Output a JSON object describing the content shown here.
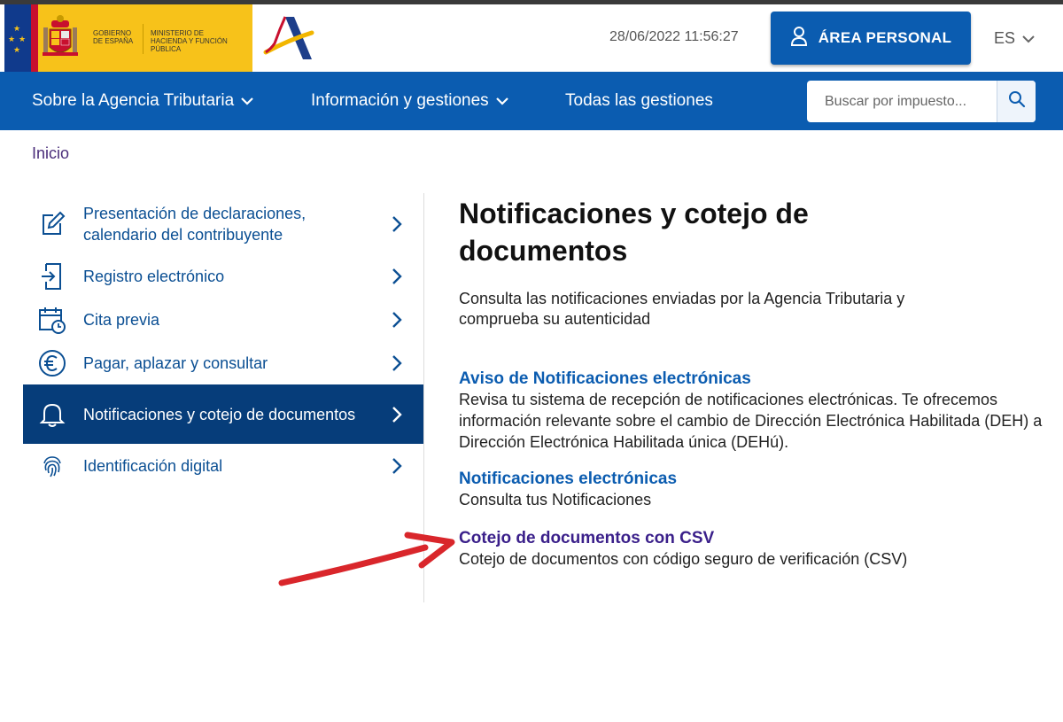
{
  "header": {
    "logo_gobierno": "GOBIERNO DE ESPAÑA",
    "logo_ministerio": "MINISTERIO DE HACIENDA Y FUNCIÓN PÚBLICA",
    "datetime": "28/06/2022 11:56:27",
    "area_personal_label": "ÁREA PERSONAL",
    "lang": "ES"
  },
  "nav": {
    "items": [
      {
        "label": "Sobre la Agencia Tributaria"
      },
      {
        "label": "Información y gestiones"
      },
      {
        "label": "Todas las gestiones"
      }
    ],
    "search_placeholder": "Buscar por impuesto..."
  },
  "breadcrumb": "Inicio",
  "sidebar": {
    "items": [
      {
        "label": "Presentación de declaraciones, calendario del contribuyente",
        "icon": "pencil-icon"
      },
      {
        "label": "Registro electrónico",
        "icon": "document-arrow-icon"
      },
      {
        "label": "Cita previa",
        "icon": "calendar-clock-icon"
      },
      {
        "label": "Pagar, aplazar y consultar",
        "icon": "euro-icon"
      },
      {
        "label": "Notificaciones y cotejo de documentos",
        "icon": "bell-icon",
        "active": true
      },
      {
        "label": "Identificación digital",
        "icon": "fingerprint-icon"
      }
    ]
  },
  "main": {
    "title": "Notificaciones y cotejo de documentos",
    "intro": "Consulta las notificaciones enviadas por la Agencia Tributaria y comprueba su autenticidad",
    "sections": [
      {
        "link": "Aviso de Notificaciones electrónicas",
        "desc": "Revisa tu sistema de recepción de notificaciones electrónicas. Te ofrecemos información relevante sobre el cambio de Dirección Electrónica Habilitada (DEH) a Dirección Electrónica Habilitada única (DEHú)."
      },
      {
        "link": "Notificaciones electrónicas",
        "desc": "Consulta tus Notificaciones"
      },
      {
        "link": "Cotejo de documentos con CSV",
        "desc": "Cotejo de documentos con código seguro de verificación (CSV)"
      }
    ]
  },
  "colors": {
    "primary": "#0b5cb0",
    "active_sidebar": "#063d7a",
    "visited_link": "#3a1f8a",
    "annotation_arrow": "#d9262b"
  }
}
